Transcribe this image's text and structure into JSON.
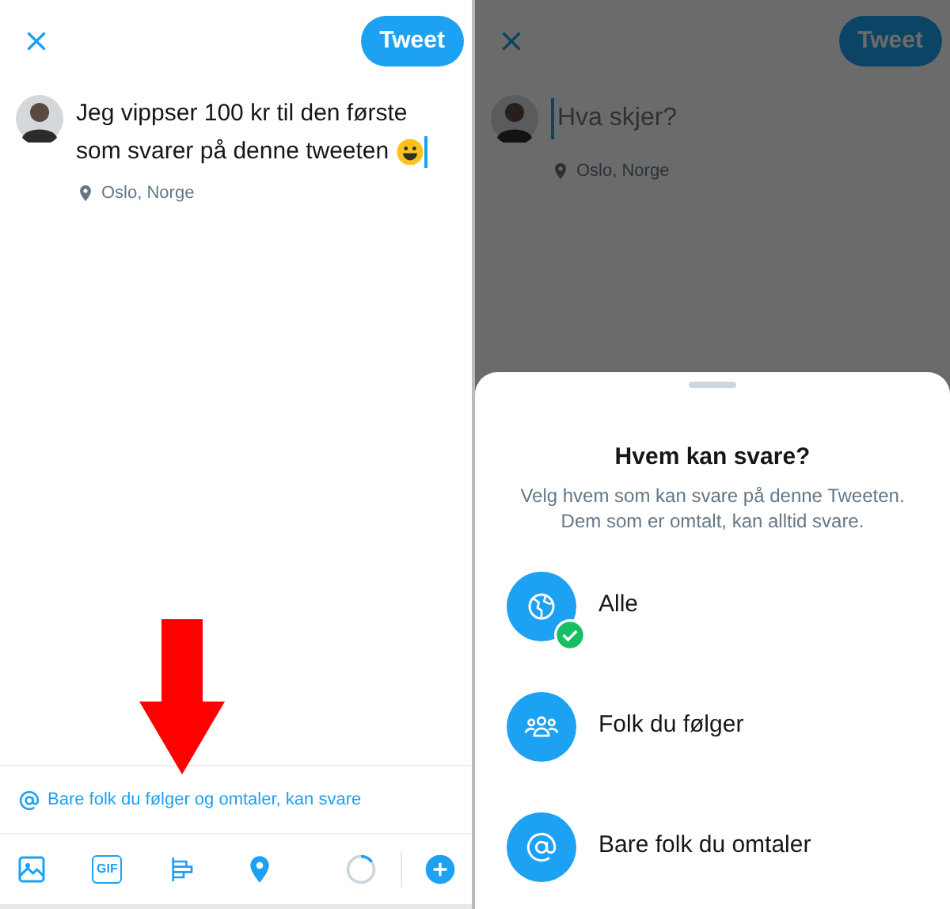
{
  "compose_screen": {
    "tweet_button": "Tweet",
    "text": "Jeg vippser 100 kr til den første som svarer på denne tweeten",
    "location": "Oslo, Norge",
    "reply_setting": "Bare folk du følger og omtaler, kan svare",
    "toolbar": [
      {
        "kind": "image"
      },
      {
        "kind": "gif",
        "label": "GIF"
      },
      {
        "kind": "poll"
      },
      {
        "kind": "location"
      }
    ],
    "counter": {
      "level": 0.15
    }
  },
  "reply_screen": {
    "tweet_button": "Tweet",
    "placeholder": "Hva skjer?",
    "location": "Oslo, Norge",
    "sheet": {
      "title": "Hvem kan svare?",
      "description": "Velg hvem som kan svare på denne Tweeten. Dem som er omtalt, kan alltid svare.",
      "options": [
        {
          "kind": "globe",
          "label": "Alle",
          "selected": true
        },
        {
          "kind": "people",
          "label": "Folk du følger",
          "selected": false
        },
        {
          "kind": "mention",
          "label": "Bare folk du omtaler",
          "selected": false
        }
      ]
    }
  }
}
